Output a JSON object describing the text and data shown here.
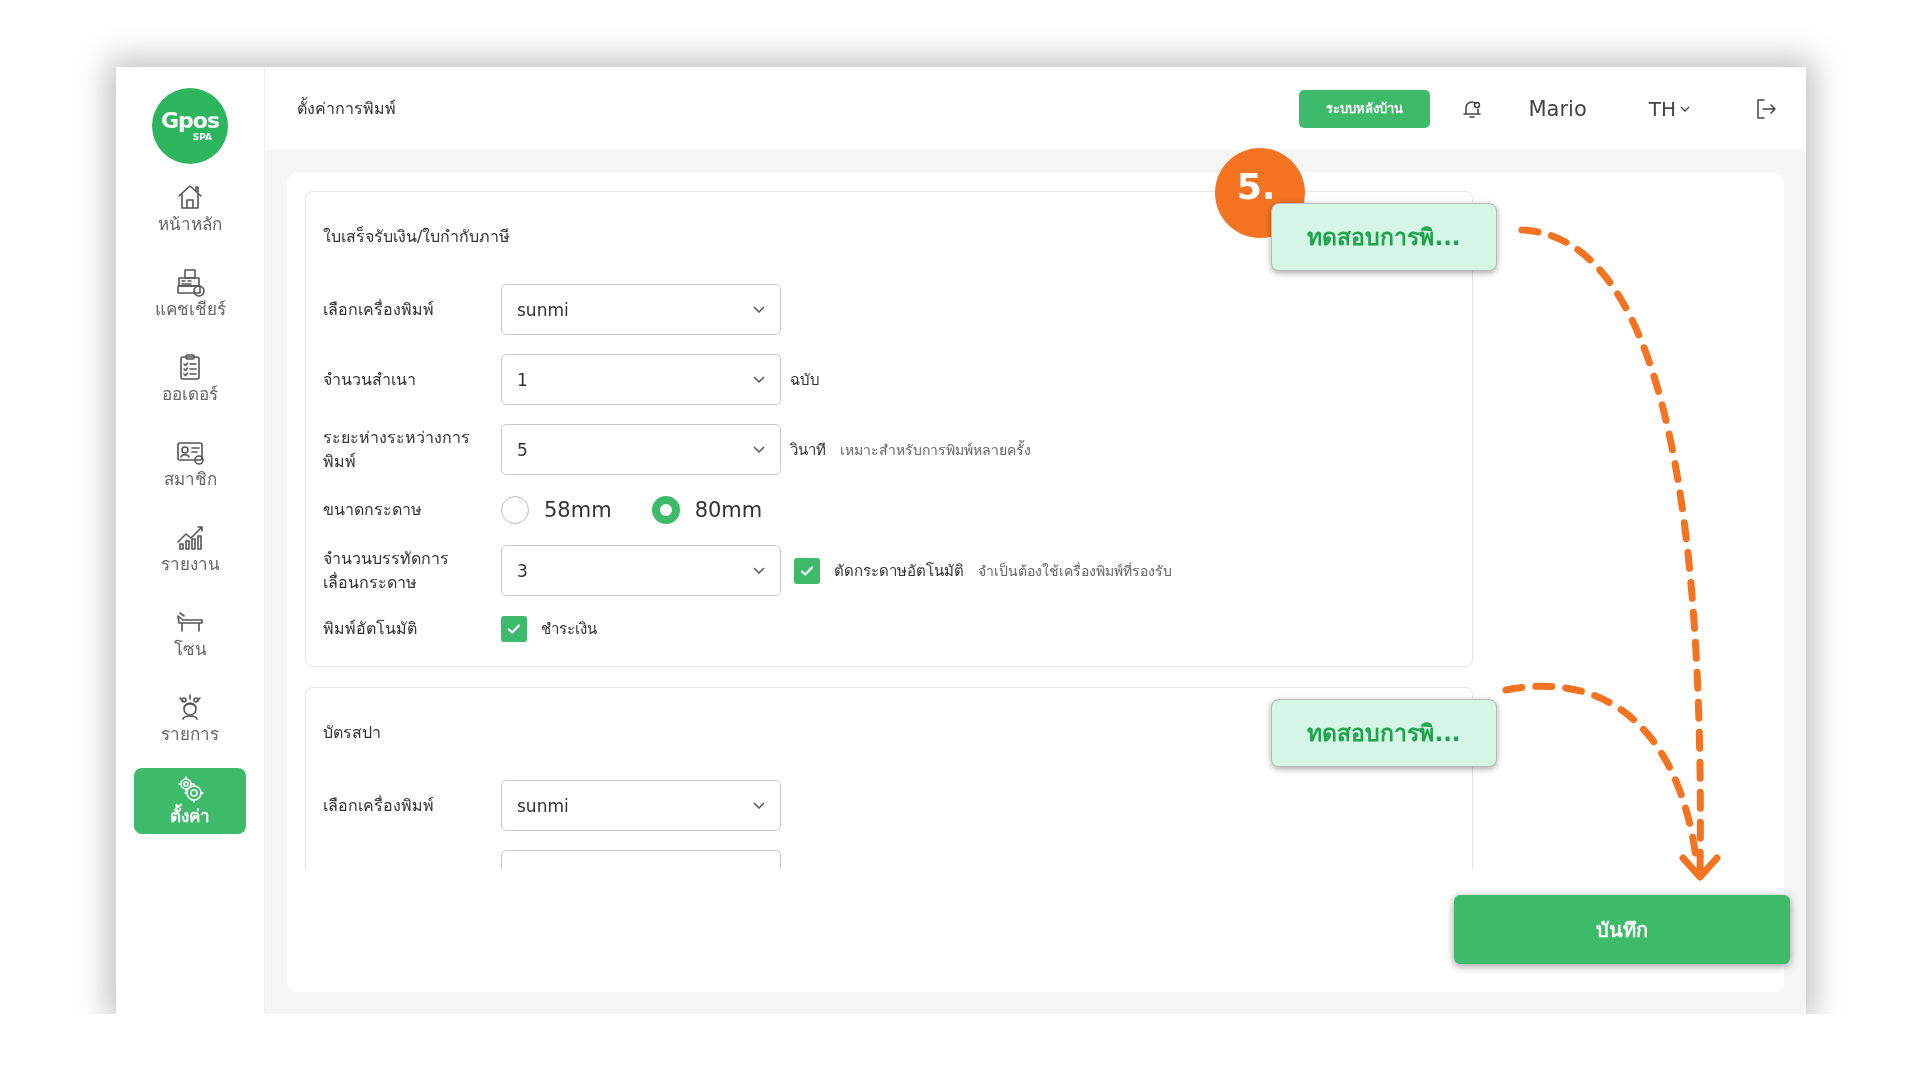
{
  "sidebar": {
    "logo": {
      "text": "Gpos",
      "subtext": "SPA"
    },
    "items": [
      {
        "label": "หน้าหลัก",
        "selected": false
      },
      {
        "label": "แคชเชียร์",
        "selected": false
      },
      {
        "label": "ออเดอร์",
        "selected": false
      },
      {
        "label": "สมาชิก",
        "selected": false
      },
      {
        "label": "รายงาน",
        "selected": false
      },
      {
        "label": "โซน",
        "selected": false
      },
      {
        "label": "รายการ",
        "selected": false
      },
      {
        "label": "ตั้งค่า",
        "selected": true
      }
    ]
  },
  "header": {
    "title": "ตั้งค่าการพิมพ์",
    "backoffice_button": "ระบบหลังบ้าน",
    "user": "Mario",
    "language": "TH"
  },
  "sections": [
    {
      "title": "ใบเสร็จรับเงิน/ใบกำกับภาษี",
      "test_button": "ทดสอบการพิ...",
      "rows": [
        {
          "kind": "select",
          "label": "เลือกเครื่องพิมพ์",
          "value": "sunmi"
        },
        {
          "kind": "select",
          "label": "จำนวนสำเนา",
          "value": "1",
          "unit": "ฉบับ"
        },
        {
          "kind": "select",
          "label": "ระยะห่างระหว่างการพิมพ์",
          "value": "5",
          "unit": "วินาที",
          "hint": "เหมาะสำหรับการพิมพ์หลายครั้ง"
        },
        {
          "kind": "radio",
          "label": "ขนาดกระดาษ",
          "options": [
            {
              "label": "58mm",
              "selected": false
            },
            {
              "label": "80mm",
              "selected": true
            }
          ]
        },
        {
          "kind": "select",
          "label": "จำนวนบรรทัดการเลื่อนกระดาษ",
          "value": "3",
          "checkbox": {
            "label": "ตัดกระดาษอัตโนมัติ",
            "checked": true
          },
          "hint": "จำเป็นต้องใช้เครื่องพิมพ์ที่รองรับ"
        },
        {
          "kind": "checkbox",
          "label": "พิมพ์อัตโนมัติ",
          "checkbox": {
            "label": "ชำระเงิน",
            "checked": true
          }
        }
      ]
    },
    {
      "title": "บัตรสปา",
      "test_button": "ทดสอบการพิ...",
      "rows": [
        {
          "kind": "select",
          "label": "เลือกเครื่องพิมพ์",
          "value": "sunmi"
        },
        {
          "kind": "cut"
        }
      ]
    }
  ],
  "save_button": "บันทึก",
  "annotation": {
    "step": "5."
  }
}
